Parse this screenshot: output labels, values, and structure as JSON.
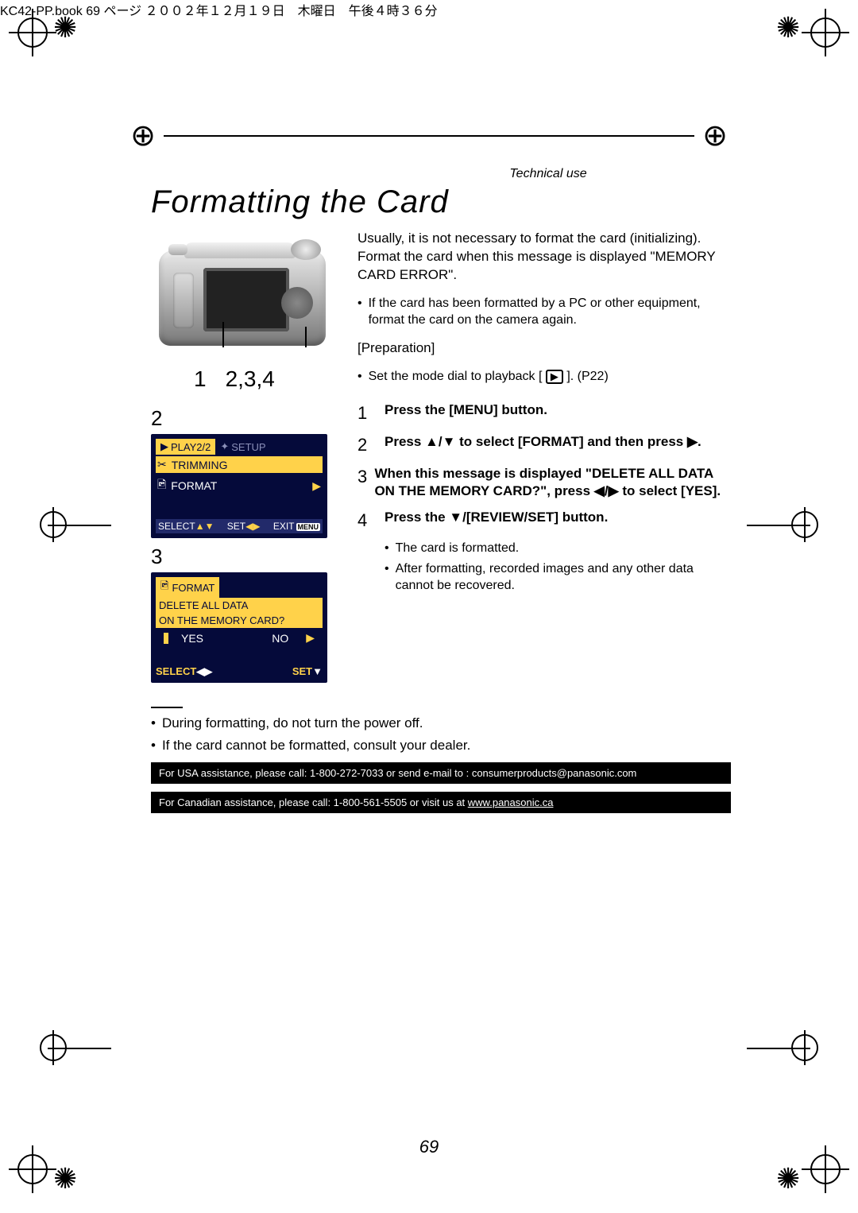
{
  "header_text": "KC42-PP.book  69 ページ  ２００２年１２月１９日　木曜日　午後４時３６分",
  "section_label": "Technical use",
  "title": "Formatting the Card",
  "camera_labels": {
    "left": "1",
    "right": "2,3,4"
  },
  "intro_paragraph": "Usually, it is not necessary to format the card (initializing). Format the card when this message is displayed \"MEMORY CARD ERROR\".",
  "intro_bullet": "If the card has been formatted by a PC or other equipment, format the card on the camera again.",
  "preparation_label": "[Preparation]",
  "preparation_bullet_pre": "Set the mode dial to playback [",
  "preparation_bullet_icon": "▶",
  "preparation_bullet_post": "]. (P22)",
  "steps": [
    {
      "n": "1",
      "text": "Press the [MENU] button."
    },
    {
      "n": "2",
      "text": "Press ▲/▼ to select [FORMAT] and then press ▶."
    },
    {
      "n": "3",
      "text": "When this message is displayed \"DELETE ALL DATA ON THE MEMORY CARD?\", press ◀/▶ to select [YES]."
    },
    {
      "n": "4",
      "text": "Press the ▼/[REVIEW/SET] button."
    }
  ],
  "post_bullets": [
    "The card is formatted.",
    "After formatting, recorded images and any other data cannot be recovered."
  ],
  "screen1": {
    "tab_left_icon": "▶",
    "tab_left": "PLAY2/2",
    "tab_right_icon": "✦",
    "tab_right": "SETUP",
    "item1_icon": "✂",
    "item1": "TRIMMING",
    "item2_icon": "🖻",
    "item2": "FORMAT",
    "foot_select": "SELECT",
    "foot_select_icon": "▲▼",
    "foot_set": "SET",
    "foot_set_icon": "◀▶",
    "foot_exit": "EXIT",
    "foot_menu": "MENU"
  },
  "screen2": {
    "title_icon": "🖻",
    "title": "FORMAT",
    "line1": "DELETE ALL DATA",
    "line2": "ON THE MEMORY CARD?",
    "yes": "YES",
    "no": "NO",
    "foot_select": "SELECT",
    "foot_select_icon": "◀▶",
    "foot_set": "SET",
    "foot_set_icon": "▼"
  },
  "screen1_step": "2",
  "screen2_step": "3",
  "notes": [
    "During formatting, do not turn the power off.",
    "If the card cannot be formatted, consult your dealer."
  ],
  "bar_us": "For USA assistance, please call: 1-800-272-7033 or send e-mail to : consumerproducts@panasonic.com",
  "bar_ca_pre": "For Canadian assistance, please call: 1-800-561-5505 or visit us at ",
  "bar_ca_link": "www.panasonic.ca",
  "page_number": "69"
}
